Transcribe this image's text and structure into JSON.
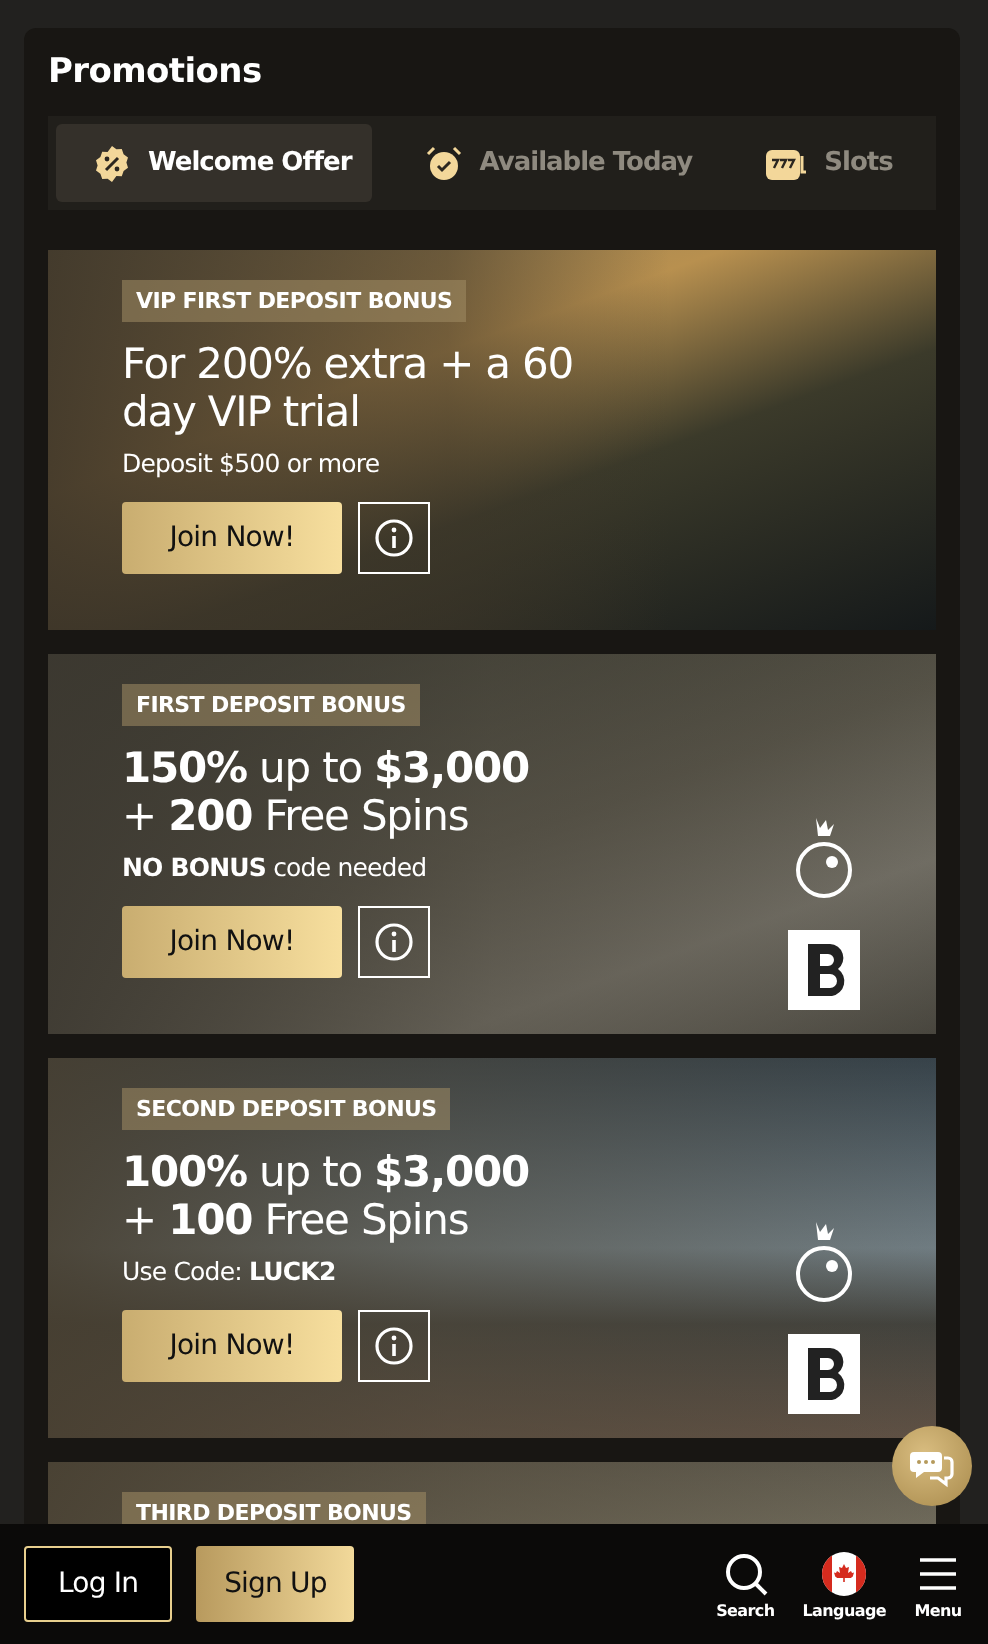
{
  "title": "Promotions",
  "tabs": [
    {
      "label": "Welcome Offer",
      "selected": true
    },
    {
      "label": "Available Today",
      "selected": false
    },
    {
      "label": "Slots",
      "selected": false
    }
  ],
  "promos": [
    {
      "tag": "VIP FIRST DEPOSIT BONUS",
      "headline": "For 200% extra + a 60\nday VIP trial",
      "note": "Deposit $500 or more",
      "button": "Join Now!",
      "partner_logos": false
    },
    {
      "tag": "FIRST DEPOSIT BONUS",
      "headline": "**150%** up to **$3,000**\n+ **200** Free Spins",
      "note": "**NO BONUS** code needed",
      "button": "Join Now!",
      "partner_logos": true
    },
    {
      "tag": "SECOND DEPOSIT BONUS",
      "headline": "**100%** up to **$3,000**\n+ **100** Free Spins",
      "note": "Use Code: **LUCK2**",
      "button": "Join Now!",
      "partner_logos": true
    },
    {
      "tag": "THIRD DEPOSIT BONUS",
      "partner_logos": false
    }
  ],
  "bottom_bar": {
    "login": "Log In",
    "signup": "Sign Up",
    "nav": [
      {
        "label": "Search"
      },
      {
        "label": "Language"
      },
      {
        "label": "Menu"
      }
    ]
  }
}
